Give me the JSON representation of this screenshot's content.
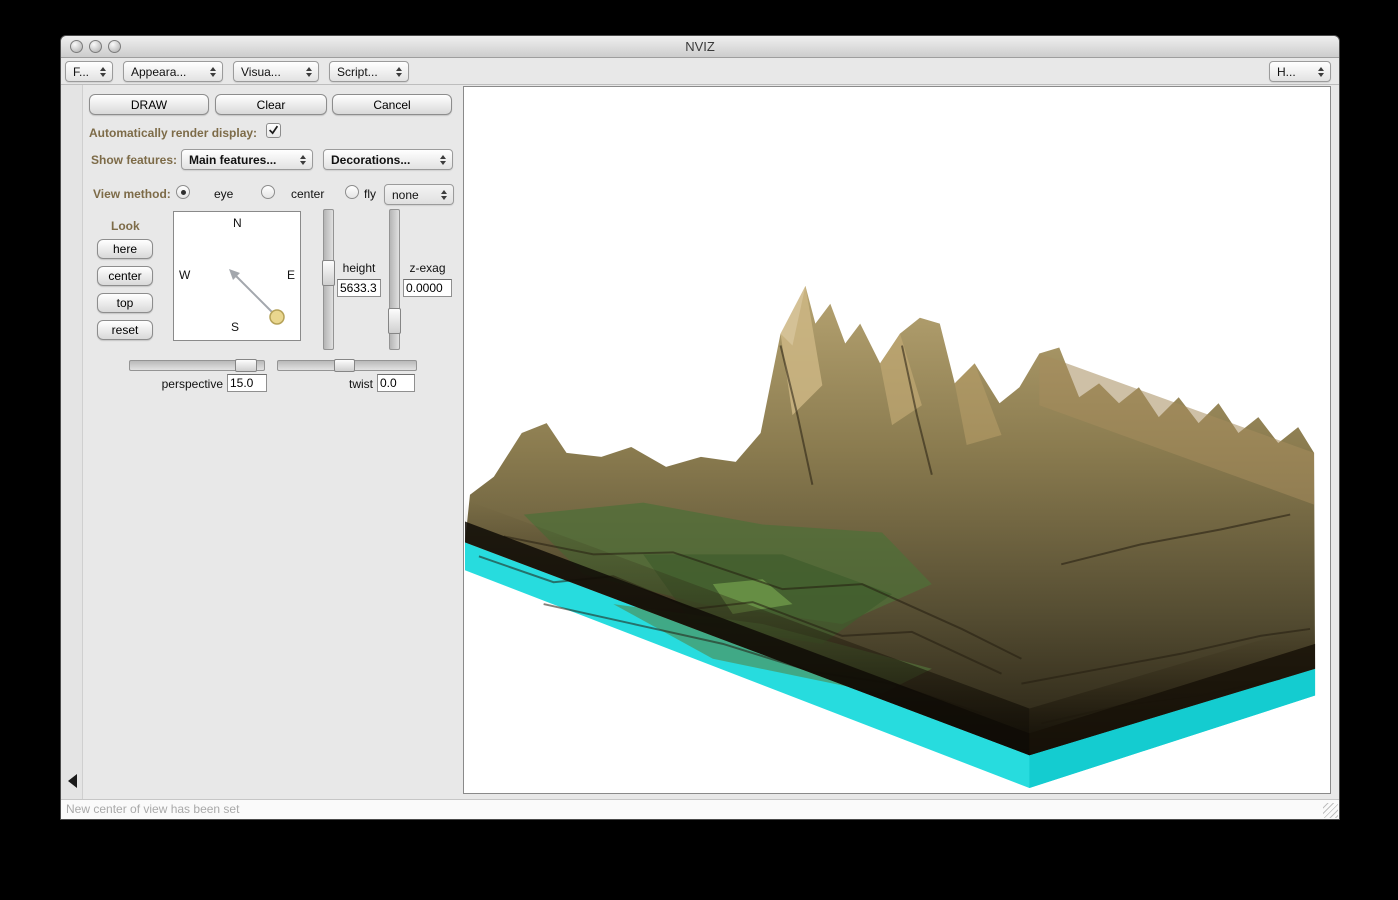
{
  "window": {
    "title": "NVIZ"
  },
  "menubar": {
    "file": "F...",
    "appearance": "Appeara...",
    "visualize": "Visua...",
    "scripting": "Script...",
    "help": "H..."
  },
  "toolbar": {
    "draw": "DRAW",
    "clear": "Clear",
    "cancel": "Cancel"
  },
  "render": {
    "auto_label": "Automatically render display:",
    "checked": true
  },
  "features": {
    "label": "Show features:",
    "main": "Main features...",
    "decorations": "Decorations..."
  },
  "view_method": {
    "label": "View method:",
    "eye": "eye",
    "center": "center",
    "fly": "fly",
    "fly_mode": "none"
  },
  "look": {
    "label": "Look",
    "buttons": [
      "here",
      "center",
      "top",
      "reset"
    ]
  },
  "compass": {
    "n": "N",
    "s": "S",
    "e": "E",
    "w": "W"
  },
  "sliders": {
    "height_label": "height",
    "height_value": "5633.3",
    "zexag_label": "z-exag",
    "zexag_value": "0.0000",
    "perspective_label": "perspective",
    "perspective_value": "15.0",
    "twist_label": "twist",
    "twist_value": "0.0"
  },
  "statusbar": {
    "message": "New center of view has been set"
  },
  "colors": {
    "label_brown": "#7d6b48",
    "slab_cyan": "#27dcde",
    "terrain_green": "#4f6f38",
    "terrain_tan": "#cdb684",
    "canvas_bg": "#ffffff"
  }
}
